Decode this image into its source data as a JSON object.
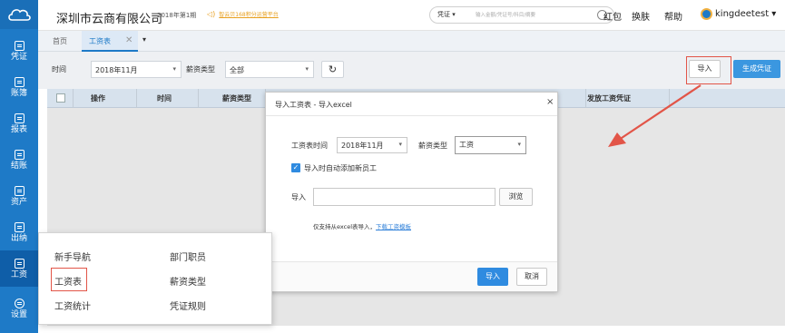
{
  "header": {
    "company": "深圳市云商有限公司",
    "period": "2018年第1期",
    "notice_text": "智云贝168积分运营平台",
    "search_type": "凭证",
    "search_placeholder": "输入金额/凭证号/科目/摘要",
    "links": [
      "红包",
      "换肤",
      "帮助"
    ],
    "username": "kingdeetest"
  },
  "nav": {
    "items": [
      "凭证",
      "账簿",
      "报表",
      "结账",
      "资产",
      "出纳",
      "工资",
      "设置"
    ],
    "active_index": 6
  },
  "tabs": {
    "home": "首页",
    "active": "工资表",
    "close": "✕",
    "more": "▾"
  },
  "toolbar": {
    "time_label": "时间",
    "time_value": "2018年11月",
    "type_label": "薪资类型",
    "type_value": "全部",
    "refresh": "↻",
    "import_label": "导入",
    "generate_label": "生成凭证"
  },
  "table": {
    "headers": [
      "操作",
      "时间",
      "薪资类型",
      "发放工资凭证"
    ]
  },
  "modal": {
    "title": "导入工资表 - 导入excel",
    "close": "×",
    "time_label": "工资表时间",
    "time_value": "2018年11月",
    "type_label": "薪资类型",
    "type_value": "工资",
    "checkbox_label": "导入时自动添加新员工",
    "checked": true,
    "import_label": "导入",
    "browse_label": "浏览",
    "note": "仅支持从excel表导入，",
    "note_link": "下载工资模板",
    "ok_label": "导入",
    "cancel_label": "取消"
  },
  "submenu": {
    "items": [
      "新手导航",
      "部门职员",
      "工资表",
      "薪资类型",
      "工资统计",
      "凭证规则"
    ]
  },
  "colors": {
    "primary": "#1e7ac7",
    "highlight": "#e25548",
    "button_blue": "#2f8be0"
  }
}
